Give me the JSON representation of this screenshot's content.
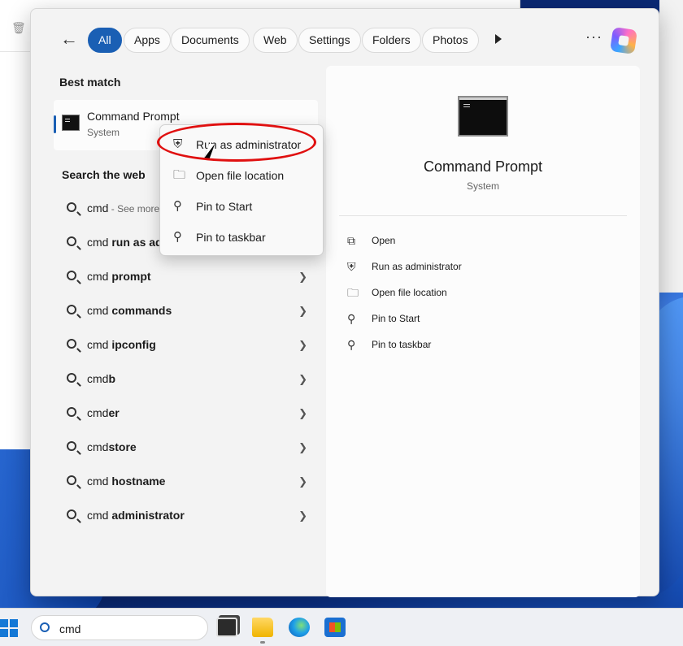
{
  "filters": {
    "all": "All",
    "apps": "Apps",
    "documents": "Documents",
    "web": "Web",
    "settings": "Settings",
    "folders": "Folders",
    "photos": "Photos"
  },
  "more_options": "···",
  "best_match": {
    "heading": "Best match",
    "title": "Command Prompt",
    "subtitle": "System"
  },
  "search_web": {
    "heading": "Search the web",
    "items": [
      {
        "prefix": "cmd",
        "bold": "",
        "suffix": " - See more search results"
      },
      {
        "prefix": "cmd ",
        "bold": "run as administrator",
        "suffix": ""
      },
      {
        "prefix": "cmd ",
        "bold": "prompt",
        "suffix": ""
      },
      {
        "prefix": "cmd ",
        "bold": "commands",
        "suffix": ""
      },
      {
        "prefix": "cmd ",
        "bold": "ipconfig",
        "suffix": ""
      },
      {
        "prefix": "cmd",
        "bold": "b",
        "suffix": ""
      },
      {
        "prefix": "cmd",
        "bold": "er",
        "suffix": ""
      },
      {
        "prefix": "cmd",
        "bold": "store",
        "suffix": ""
      },
      {
        "prefix": "cmd ",
        "bold": "hostname",
        "suffix": ""
      },
      {
        "prefix": "cmd ",
        "bold": "administrator",
        "suffix": ""
      }
    ]
  },
  "preview": {
    "title": "Command Prompt",
    "subtitle": "System",
    "actions": [
      {
        "label": "Open",
        "icon": "open-external-icon"
      },
      {
        "label": "Run as administrator",
        "icon": "shield-icon"
      },
      {
        "label": "Open file location",
        "icon": "folder-icon"
      },
      {
        "label": "Pin to Start",
        "icon": "pin-icon"
      },
      {
        "label": "Pin to taskbar",
        "icon": "pin-icon"
      }
    ]
  },
  "context_menu": {
    "items": [
      {
        "label": "Run as administrator",
        "icon": "shield-icon"
      },
      {
        "label": "Open file location",
        "icon": "folder-icon"
      },
      {
        "label": "Pin to Start",
        "icon": "pin-icon"
      },
      {
        "label": "Pin to taskbar",
        "icon": "pin-icon"
      }
    ]
  },
  "taskbar": {
    "search_value": "cmd"
  },
  "colors": {
    "accent": "#1a5fb4",
    "annotation": "#e01010"
  }
}
